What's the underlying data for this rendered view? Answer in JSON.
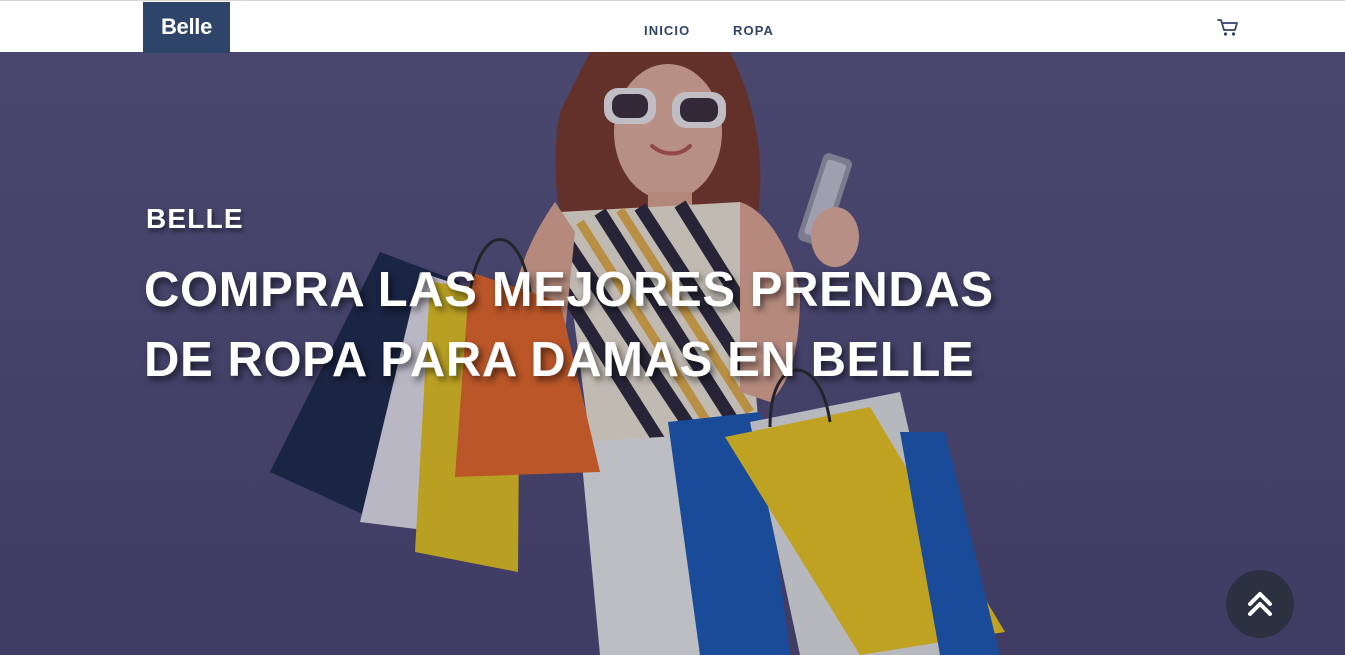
{
  "navbar": {
    "brand": "Belle",
    "links": [
      {
        "label": "INICIO"
      },
      {
        "label": "ROPA"
      }
    ],
    "cart_icon": "shopping-cart-icon"
  },
  "hero": {
    "eyebrow": "BELLE",
    "title_line1": "COMPRA LAS MEJORES PRENDAS",
    "title_line2": "DE ROPA PARA DAMAS EN BELLE",
    "background_image": "woman-with-shopping-bags",
    "overlay_color": "#534f79"
  },
  "scroll_top": {
    "icon": "double-chevron-up-icon"
  },
  "colors": {
    "brand": "#2f4469",
    "nav_text": "#2f4469",
    "hero_bg": "#534f79",
    "scroll_button": "#2b3140",
    "text_light": "#ffffff"
  }
}
